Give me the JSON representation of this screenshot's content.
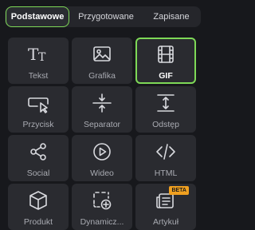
{
  "tabs": [
    {
      "label": "Podstawowe",
      "active": true
    },
    {
      "label": "Przygotowane",
      "active": false
    },
    {
      "label": "Zapisane",
      "active": false
    }
  ],
  "tiles": [
    {
      "label": "Tekst",
      "icon": "text-icon"
    },
    {
      "label": "Grafika",
      "icon": "image-icon"
    },
    {
      "label": "GIF",
      "icon": "film-icon",
      "selected": true
    },
    {
      "label": "Przycisk",
      "icon": "button-icon"
    },
    {
      "label": "Separator",
      "icon": "separator-icon"
    },
    {
      "label": "Odstęp",
      "icon": "spacer-icon"
    },
    {
      "label": "Social",
      "icon": "share-icon"
    },
    {
      "label": "Wideo",
      "icon": "play-icon"
    },
    {
      "label": "HTML",
      "icon": "code-icon"
    },
    {
      "label": "Produkt",
      "icon": "box-icon"
    },
    {
      "label": "Dynamicz...",
      "icon": "dynamic-add-icon"
    },
    {
      "label": "Artykuł",
      "icon": "article-icon",
      "badge": "BETA"
    }
  ],
  "colors": {
    "accent": "#7ed957",
    "background": "#17181c",
    "tile": "#2a2b30",
    "badge": "#f0a020"
  }
}
